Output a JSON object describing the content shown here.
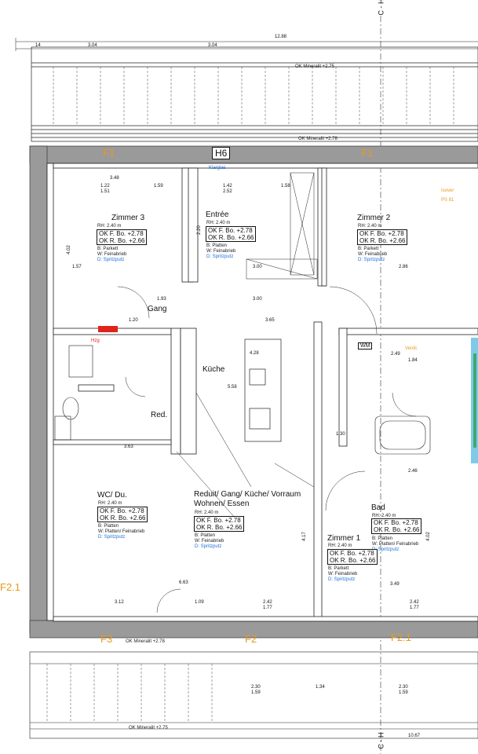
{
  "axis_labels": {
    "top": "C - H",
    "bottom": "C - H"
  },
  "overall_dims": {
    "total_top": "12.88",
    "total_bottom": "10.67",
    "top_segments": [
      "14",
      "3.04",
      "14",
      "3.04",
      "14"
    ]
  },
  "roof_labels": {
    "top": "OK Mineralit +2.75",
    "top2": "OK Mineralit +2.78",
    "bottom": "OK Mineralit +2.78",
    "bottom2": "OK Mineralit +2.75"
  },
  "window_tags": [
    "F1",
    "F1",
    "F3",
    "F2",
    "F2.1",
    "F2.1"
  ],
  "door_tag": "H6",
  "rooms": [
    {
      "name": "Zimmer 3",
      "rh": "RH: 2.40 m",
      "ok_f": "OK F. Bo.  +2.78",
      "ok_r": "OK R. Bo.  +2.66",
      "b": "B:  Parkett",
      "w": "W:  Feinabrieb",
      "d": "D:  Spritzputz"
    },
    {
      "name": "Entrée",
      "rh": "RH: 2.40 m",
      "ok_f": "OK F. Bo.  +2.78",
      "ok_r": "OK R. Bo.  +2.66",
      "b": "B:  Platten",
      "w": "W:  Feinabrieb",
      "d": "D:  Spritzputz"
    },
    {
      "name": "Zimmer 2",
      "rh": "RH: 2.40 m",
      "ok_f": "OK F. Bo.  +2.78",
      "ok_r": "OK R. Bo.  +2.66",
      "b": "B:  Parkett",
      "w": "W:  Feinabrieb",
      "d": "D:  Spritzputz"
    },
    {
      "name": "WC/ Du.",
      "rh": "RH: 2.40 m",
      "ok_f": "OK F. Bo.  +2.78",
      "ok_r": "OK R. Bo.  +2.66",
      "b": "B:  Platten",
      "w": "W:  Platten/ Feinabrieb",
      "d": "D:  Spritzputz"
    },
    {
      "name": "Reduit/ Gang/ Küche/ Vorraum",
      "name2": "Wohnen/ Essen",
      "rh": "RH: 2.40 m",
      "ok_f": "OK F. Bo.  +2.78",
      "ok_r": "OK R. Bo.  +2.66",
      "b": "B:  Platten",
      "w": "W:  Feinabrieb",
      "d": "D:  Spritzputz"
    },
    {
      "name": "Bad",
      "rh": "RH: 2.40 m",
      "ok_f": "OK F. Bo.  +2.78",
      "ok_r": "OK R. Bo.  +2.66",
      "b": "B:  Platten",
      "w": "W:  Platten/ Feinabrieb",
      "d": "D:  Spritzputz"
    },
    {
      "name": "Zimmer 1",
      "rh": "RH: 2.40 m",
      "ok_f": "OK F. Bo.  +2.78",
      "ok_r": "OK R. Bo.  +2.66",
      "b": "B:  Parkett",
      "w": "W:  Feinabrieb",
      "d": "D:  Spritzputz"
    }
  ],
  "labels": {
    "gang": "Gang",
    "kueche": "Küche",
    "red": "Red.",
    "wm": "WM",
    "klarglas": "Klarglas",
    "ventil": "Ventil.",
    "isover": "Isover",
    "ps": "PS 81",
    "hzg": "Hzg"
  },
  "dims": [
    "3.48",
    "1.59",
    "1.42",
    "2.52",
    "1.58",
    "3.00",
    "2.86",
    "1.93",
    "3.00",
    "1.20",
    "3.65",
    "4.28",
    "5.58",
    "3.63",
    "6.63",
    "3.12",
    "1.09",
    "2.42",
    "1.77",
    "2.42",
    "1.77",
    "3.49",
    "2.46",
    "1.84",
    "2.49",
    "1.30",
    "4.17",
    "2.20",
    "1.22",
    "1.51",
    "2.30",
    "1.59",
    "1.34",
    "2.30",
    "1.59",
    "1.57",
    "4.02",
    "4.02"
  ],
  "colors": {
    "wall": "#9a9a9a",
    "window_tag": "#e79a1b",
    "cyan": "#2aa7d8",
    "green": "#2a9a3a",
    "red": "#e0241b"
  }
}
